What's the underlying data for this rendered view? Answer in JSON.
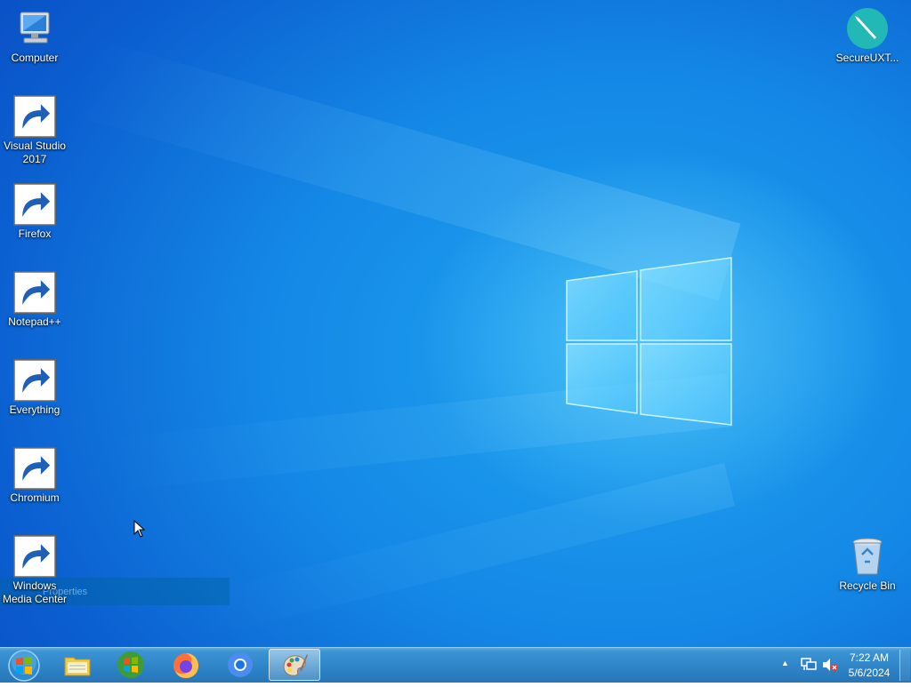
{
  "desktop_icons": {
    "computer": {
      "label": "Computer"
    },
    "visual_studio": {
      "label_line1": "Visual Studio",
      "label_line2": "2017"
    },
    "firefox": {
      "label": "Firefox"
    },
    "notepadpp": {
      "label": "Notepad++"
    },
    "everything": {
      "label": "Everything"
    },
    "chromium": {
      "label": "Chromium"
    },
    "wmc": {
      "label_line1": "Windows",
      "label_line2": "Media Center"
    },
    "secureuxt": {
      "label": "SecureUXT..."
    },
    "recycle_bin": {
      "label": "Recycle Bin"
    }
  },
  "context_ghost": {
    "text": "Properties"
  },
  "taskbar": {
    "items": [
      "start-orb",
      "file-explorer",
      "windows-media-center",
      "firefox",
      "chromium",
      "paint"
    ],
    "active_item": "paint"
  },
  "clock": {
    "time": "7:22 AM",
    "date": "5/6/2024"
  },
  "colors": {
    "accent": "#1488e6",
    "taskbar": "#2f86c9"
  }
}
